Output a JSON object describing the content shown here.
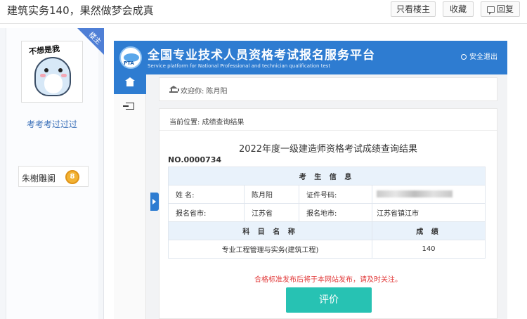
{
  "post": {
    "title": "建筑实务140，果然做梦会成真",
    "buttons": {
      "only_author": "只看楼主",
      "favorite": "收藏",
      "reply": "回复"
    }
  },
  "user": {
    "badge": "楼主",
    "avatar_caption": "不想是我",
    "name": "考考考过过过",
    "level_name": "朱榭雕阑",
    "level_number": "8"
  },
  "platform": {
    "logo_text": "PTA",
    "title": "全国专业技术人员资格考试报名服务平台",
    "subtitle": "Service platform for National Professional and technician qualification test",
    "logout": "安全退出",
    "welcome": "欢迎你:  陈月阳",
    "breadcrumb": "当前位置:  成绩查询结果",
    "result_title": "2022年度一级建造师资格考试成绩查询结果",
    "serial": "NO.0000734",
    "candidate_header": "考 生 信 息",
    "labels": {
      "name": "姓    名:",
      "id_no": "证件号码:",
      "province": "报名省市:",
      "region": "报名地市:"
    },
    "values": {
      "name": "陈月阳",
      "province": "江苏省",
      "region": "江苏省镇江市"
    },
    "score_headers": {
      "subject": "科 目 名 称",
      "score": "成 绩"
    },
    "scores": [
      {
        "subject": "专业工程管理与实务(建筑工程)",
        "score": "140"
      }
    ],
    "notice": "合格标准发布后将于本网站发布，请及时关注。",
    "evaluate_button": "评价"
  },
  "colors": {
    "banner_blue": "#2e7cd1",
    "evaluate_teal": "#27c2b3",
    "notice_red": "#e23b3b",
    "username_blue": "#3a6fb8"
  }
}
